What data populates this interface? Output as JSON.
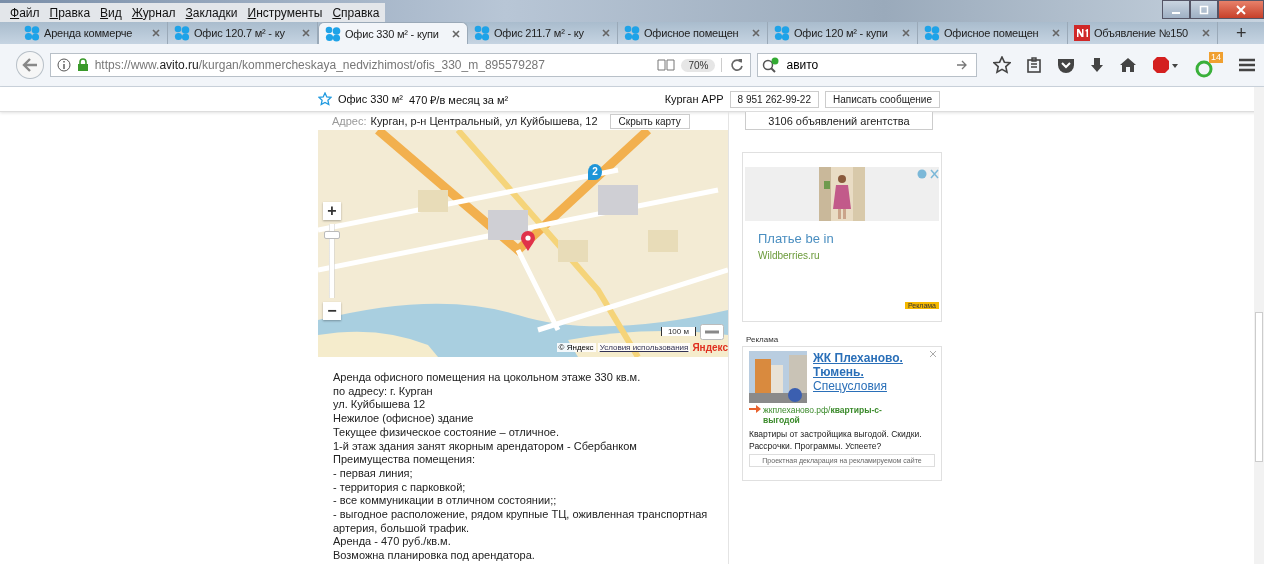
{
  "menu_bar": [
    "Файл",
    "Правка",
    "Вид",
    "Журнал",
    "Закладки",
    "Инструменты",
    "Справка"
  ],
  "tabs": [
    {
      "label": "Аренда коммерче",
      "selected": false,
      "kind": "avito"
    },
    {
      "label": "Офис 120.7 м² - ку",
      "selected": false,
      "kind": "avito"
    },
    {
      "label": "Офис 330 м² - купи",
      "selected": true,
      "kind": "avito"
    },
    {
      "label": "Офис 211.7 м² - ку",
      "selected": false,
      "kind": "avito"
    },
    {
      "label": "Офисное помещен",
      "selected": false,
      "kind": "avito"
    },
    {
      "label": "Офис 120 м² - купи",
      "selected": false,
      "kind": "avito"
    },
    {
      "label": "Офисное помещен",
      "selected": false,
      "kind": "avito"
    },
    {
      "label": "Объявление №150",
      "selected": false,
      "kind": "news"
    }
  ],
  "new_tab": "+",
  "address_bar": {
    "scheme": "https://www.",
    "host": "avito.ru",
    "path": "/kurgan/kommercheskaya_nedvizhimost/ofis_330_m_895579287",
    "zoom": "70%"
  },
  "search": {
    "value": "авито"
  },
  "addon_badge": "14",
  "listing_header": {
    "title": "Офис 330 м²",
    "price": "470 ₽/в месяц за м²",
    "seller": "Курган APP",
    "phone": "8 951 262-99-22",
    "message_button": "Написать сообщение"
  },
  "address": {
    "label": "Адрес:",
    "value": "Курган, р-н Центральный, ул Куйбышева, 12",
    "toggle_button": "Скрыть карту"
  },
  "map": {
    "zoom_level": {
      "level": 0.9
    },
    "zoom_in": "+",
    "zoom_out": "−",
    "cluster": "2",
    "scale": "100 м",
    "copyright": "© Яндекс",
    "terms_link": "Условия использования",
    "logo": "Яндекс"
  },
  "description": [
    "Аренда офисного помещения на цокольном этаже 330 кв.м.",
    "по адресу: г. Курган",
    "ул. Куйбышева 12",
    "Нежилое (офисное) здание",
    "Текущее физическое состояние – отличное.",
    "1-й этаж здания занят якорным арендатором - Сбербанком",
    "Преимущества помещения:",
    "- первая линия;",
    "- территория с парковкой;",
    "- все коммуникации в отличном состоянии;;",
    "- выгодное расположение, рядом крупные ТЦ, оживленная транспортная",
    "артерия, большой трафик.",
    "Аренда - 470 руб./кв.м.",
    "Возможна планировка под арендатора."
  ],
  "sidebar": {
    "agency_button": "3106 объявлений агентства",
    "ad_1": {
      "title": "Платье be in",
      "domain": "Wildberries.ru",
      "badge": "Реклама"
    },
    "ad_2_label": "Реклама",
    "ad_2": {
      "title_lines": [
        "ЖК Плеханово.",
        "Тюмень.",
        "Спецусловия"
      ],
      "url": "жкплеханово.рф/**квартиры-с-выгодой**",
      "text": "Квартиры от застройщика выгодой. Скидки. Рассрочки. Программы. Успеете?",
      "footer": "Проектная декларация на рекламируемом сайте"
    }
  }
}
